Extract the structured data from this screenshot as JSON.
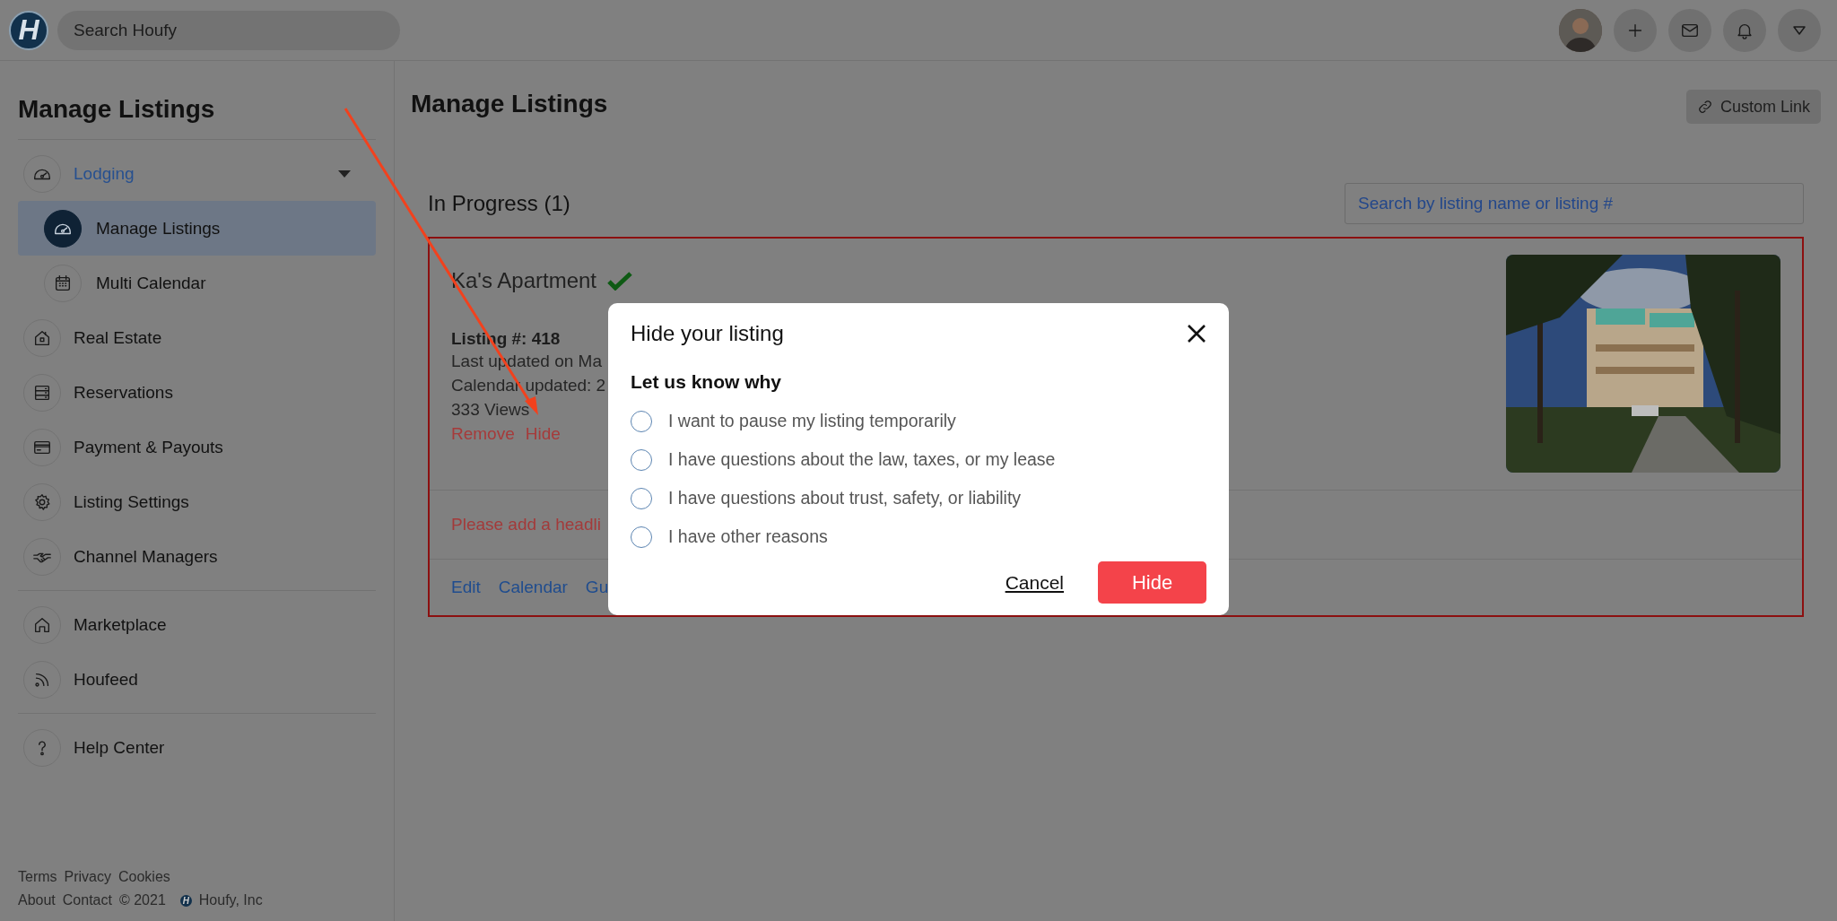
{
  "topbar": {
    "logo_letter": "H",
    "search_placeholder": "Search Houfy"
  },
  "sidebar": {
    "title": "Manage Listings",
    "sections": [
      {
        "items": [
          {
            "label": "Lodging",
            "expanded": true,
            "selected": false,
            "children": [
              {
                "label": "Manage Listings",
                "selected": true
              },
              {
                "label": "Multi Calendar",
                "selected": false
              }
            ]
          },
          {
            "label": "Real Estate",
            "selected": false
          },
          {
            "label": "Reservations",
            "selected": false
          },
          {
            "label": "Payment & Payouts",
            "selected": false
          },
          {
            "label": "Listing Settings",
            "selected": false
          },
          {
            "label": "Channel Managers",
            "selected": false
          }
        ]
      },
      {
        "items": [
          {
            "label": "Marketplace",
            "selected": false
          },
          {
            "label": "Houfeed",
            "selected": false
          }
        ]
      },
      {
        "items": [
          {
            "label": "Help Center",
            "selected": false
          }
        ]
      }
    ]
  },
  "footer": {
    "row_1": [
      "Terms",
      "Privacy",
      "Cookies"
    ],
    "row_2": [
      "About",
      "Contact"
    ],
    "copyright": "© 2021",
    "logo_letter": "H",
    "company": "Houfy, Inc"
  },
  "main": {
    "title": "Manage Listings",
    "custom_link_button": "Custom Link",
    "section_title": "In Progress (1)",
    "search_placeholder": "Search by listing name or listing #",
    "listing": {
      "title": "Ka's Apartment",
      "verified": true,
      "number": "Listing #: 418",
      "details": [
        "Last updated on Ma",
        "Calendar updated: 2",
        "333 Views"
      ],
      "actions": [
        "Remove",
        "Hide"
      ],
      "warning": "Please add a headli",
      "links": [
        "Edit",
        "Calendar",
        "Gu"
      ],
      "photo": {
        "kind": "picture"
      }
    }
  },
  "modal": {
    "title": "Hide your listing",
    "question": "Let us know why",
    "options": [
      {
        "label": "I want to pause my listing temporarily",
        "selected": false
      },
      {
        "label": "I have questions about the law, taxes, or my lease",
        "selected": false
      },
      {
        "label": "I have questions about trust, safety, or liability",
        "selected": false
      },
      {
        "label": "I have other reasons",
        "selected": false
      }
    ],
    "cancel": "Cancel",
    "confirm": "Hide"
  }
}
